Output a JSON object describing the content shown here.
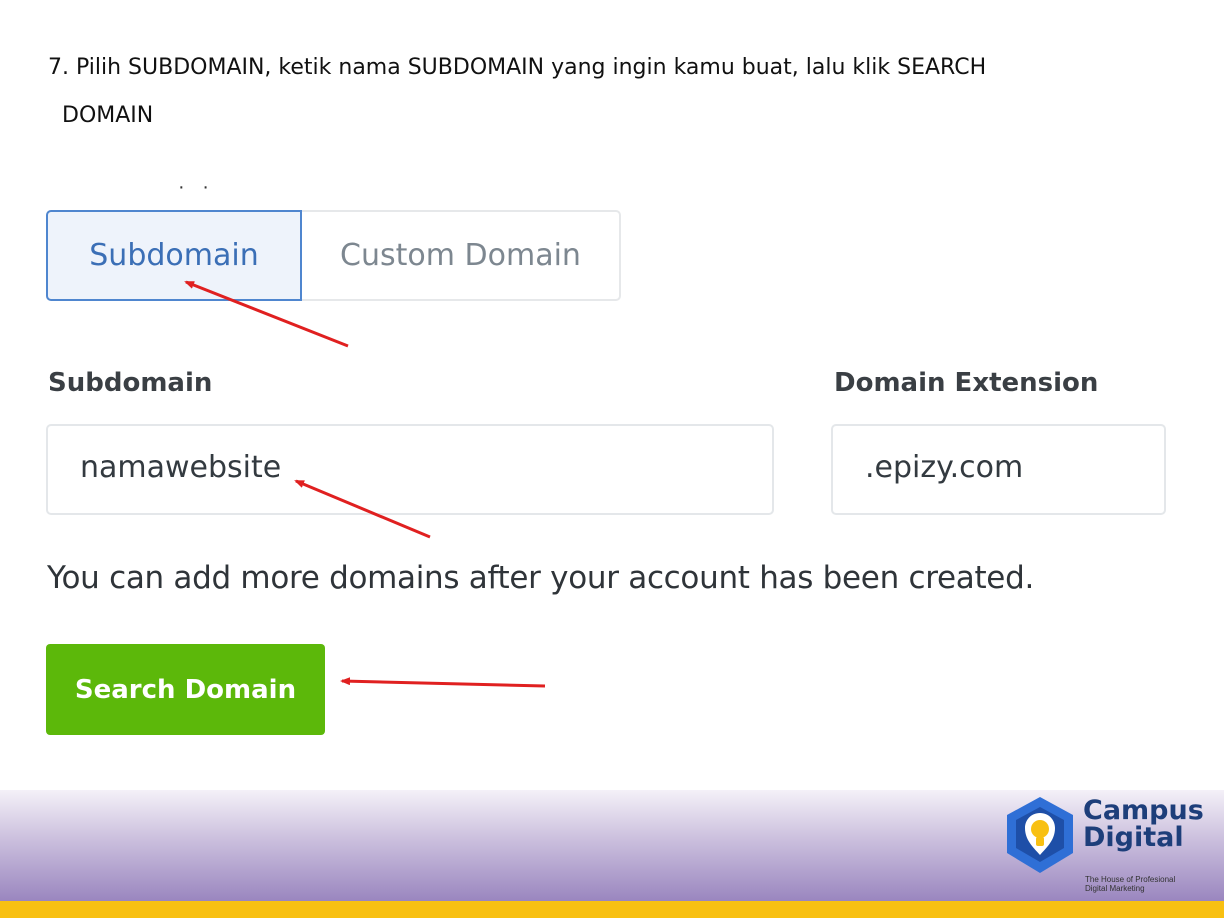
{
  "instruction": {
    "line1": "7. Pilih SUBDOMAIN, ketik nama SUBDOMAIN yang ingin kamu buat, lalu klik SEARCH",
    "line2": "DOMAIN"
  },
  "cut_text": "· ·",
  "domain_tabs": {
    "subdomain_label": "Subdomain",
    "custom_label": "Custom Domain",
    "selected": "Subdomain"
  },
  "form": {
    "subdomain_label": "Subdomain",
    "subdomain_value": "namawebsite",
    "extension_label": "Domain Extension",
    "extension_value": ".epizy.com",
    "help_text": "You can add more domains after your account has been created.",
    "search_button_label": "Search Domain"
  },
  "logo": {
    "line1": "Campus",
    "line2": "Digital",
    "tagline_1": "The House of Profesional",
    "tagline_2": "Digital Marketing"
  },
  "colors": {
    "accent_blue": "#4f86cf",
    "button_green": "#5cb80a",
    "arrow_red": "#e02020",
    "footer_purple": "#9a86bf",
    "footer_yellow": "#f8c012"
  }
}
